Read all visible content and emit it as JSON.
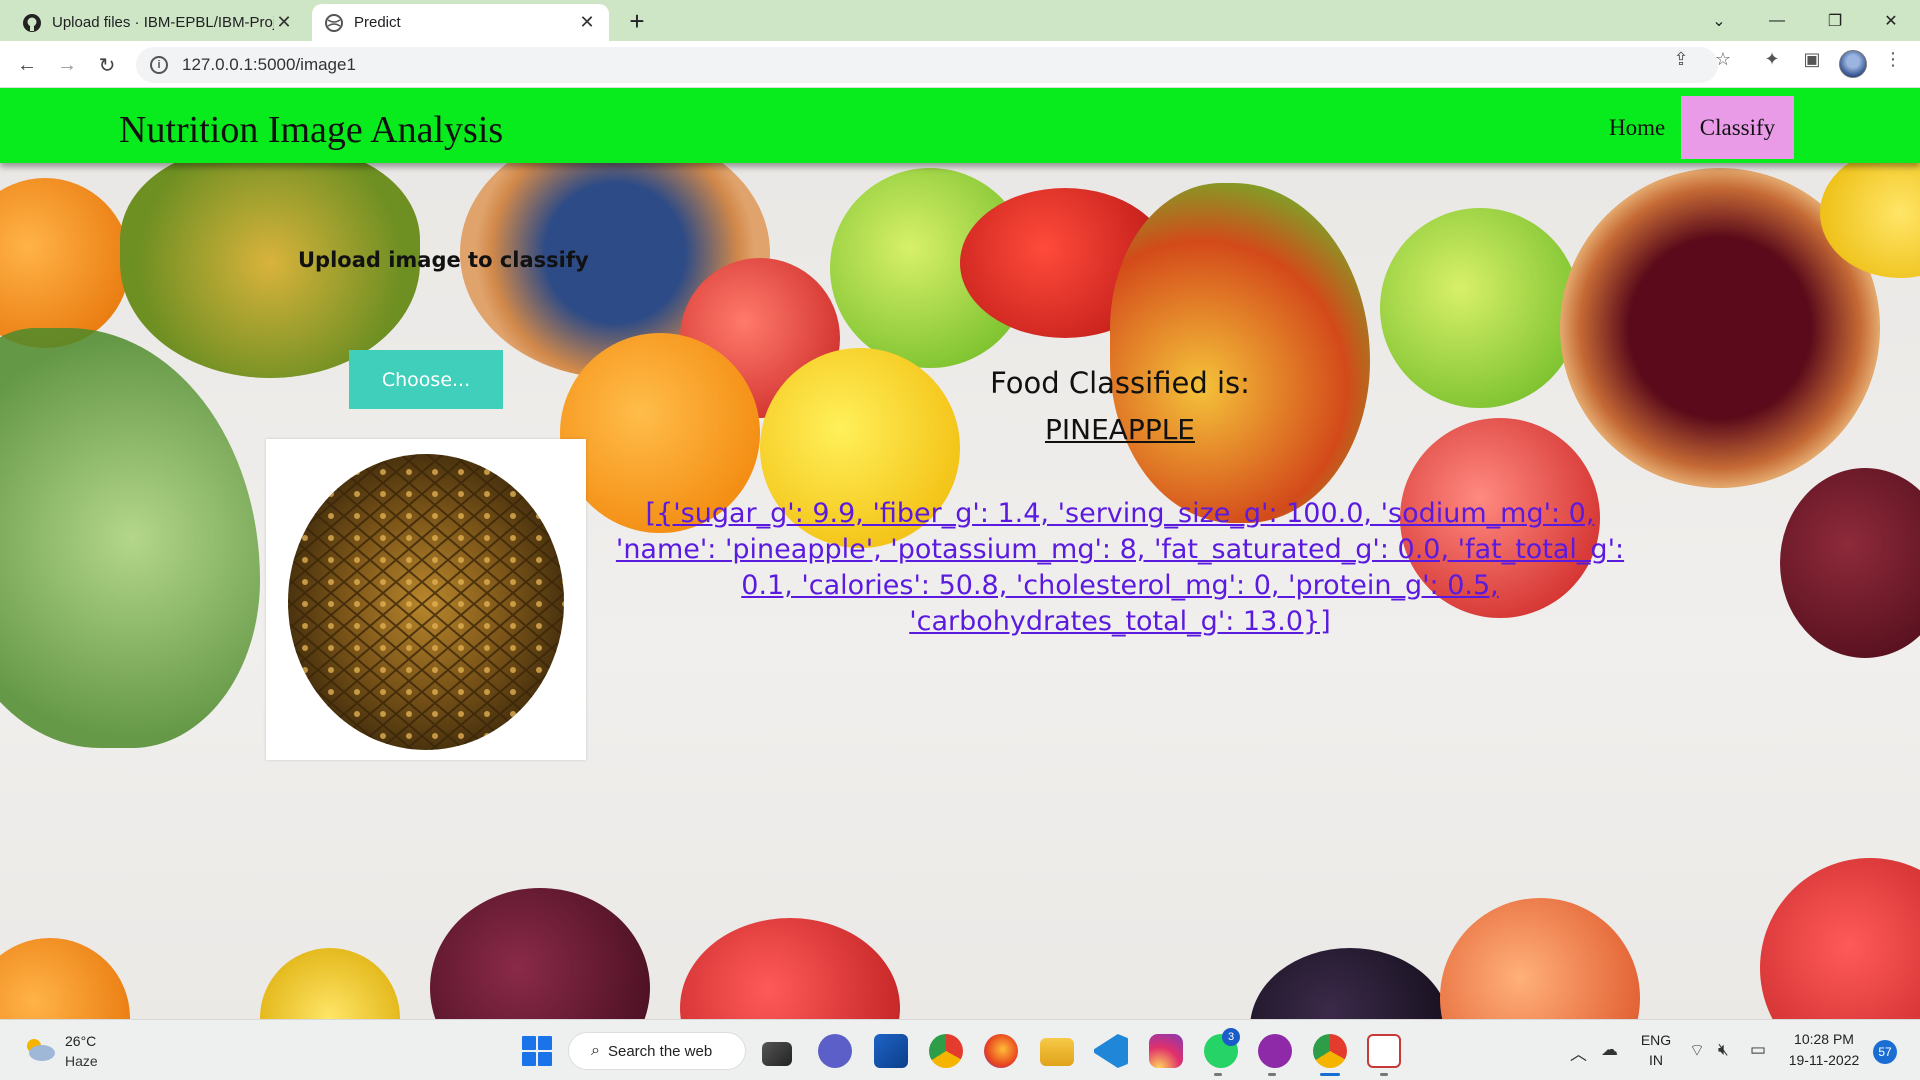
{
  "browser": {
    "tabs": [
      {
        "title": "Upload files · IBM-EPBL/IBM-Proj",
        "active": false
      },
      {
        "title": "Predict",
        "active": true
      }
    ],
    "url": "127.0.0.1:5000/image1"
  },
  "navbar": {
    "brand": "Nutrition Image Analysis",
    "links": [
      "Home",
      "Classify"
    ],
    "colors": {
      "bar": "#08eb1c",
      "active_link": "#ea9be8"
    }
  },
  "upload": {
    "heading": "Upload image to classify",
    "choose_label": "Choose..."
  },
  "result": {
    "label": "Food Classified is:",
    "food": "PINEAPPLE",
    "nutrition_text": "[{'sugar_g': 9.9, 'fiber_g': 1.4, 'serving_size_g': 100.0, 'sodium_mg': 0, 'name': 'pineapple', 'potassium_mg': 8, 'fat_saturated_g': 0.0, 'fat_total_g': 0.1, 'calories': 50.8, 'cholesterol_mg': 0, 'protein_g': 0.5, 'carbohydrates_total_g': 13.0}]"
  },
  "taskbar": {
    "weather_temp": "26°C",
    "weather_condition": "Haze",
    "search_label": "Search the web",
    "whatsapp_badge": "3",
    "language": "ENG",
    "region": "IN",
    "time": "10:28 PM",
    "date": "19-11-2022",
    "notification_count": "57"
  }
}
